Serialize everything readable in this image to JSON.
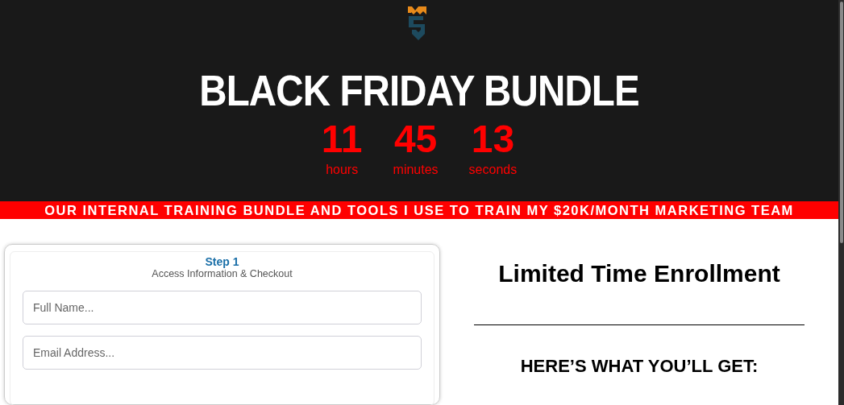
{
  "header": {
    "title": "BLACK FRIDAY BUNDLE",
    "countdown": [
      {
        "value": "11",
        "unit": "hours"
      },
      {
        "value": "45",
        "unit": "minutes"
      },
      {
        "value": "13",
        "unit": "seconds"
      }
    ]
  },
  "banner": "OUR INTERNAL TRAINING BUNDLE AND TOOLS I USE TO TRAIN MY $20K/MONTH MARKETING TEAM",
  "form": {
    "step": "Step 1",
    "subtitle": "Access Information & Checkout",
    "fields": [
      {
        "placeholder": "Full Name..."
      },
      {
        "placeholder": "Email Address..."
      }
    ]
  },
  "offer": {
    "heading": "Limited Time Enrollment",
    "subheading": "HERE’S WHAT YOU’LL GET:"
  }
}
